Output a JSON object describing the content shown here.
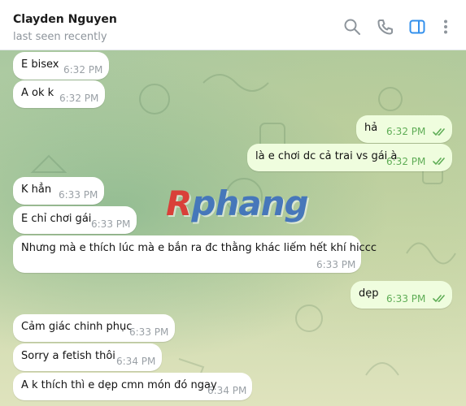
{
  "header": {
    "contact_name": "Clayden Nguyen",
    "status": "last seen recently",
    "icons": [
      "search-icon",
      "phone-icon",
      "sidebar-toggle-icon",
      "more-vertical-icon"
    ],
    "accent_color": "#3390ec"
  },
  "watermark": {
    "first": "R",
    "rest": "phang"
  },
  "messages": [
    {
      "dir": "in",
      "text": "E bisex",
      "time": "6:32 PM"
    },
    {
      "dir": "in",
      "text": "A ok k",
      "time": "6:32 PM"
    },
    {
      "dir": "out",
      "text": "hả",
      "time": "6:32 PM",
      "read": true
    },
    {
      "dir": "out",
      "text": "là e chơi dc cả trai vs gái à",
      "time": "6:32 PM",
      "read": true
    },
    {
      "dir": "in",
      "text": "K hẳn",
      "time": "6:33 PM"
    },
    {
      "dir": "in",
      "text": "E chỉ chơi gái",
      "time": "6:33 PM"
    },
    {
      "dir": "in",
      "text": "Nhưng mà e thích lúc mà e bắn ra đc thằng khác liếm hết khí hiccc",
      "time": "6:33 PM"
    },
    {
      "dir": "out",
      "text": "dẹp",
      "time": "6:33 PM",
      "read": true
    },
    {
      "dir": "in",
      "text": "Cảm giác chinh phục",
      "time": "6:33 PM"
    },
    {
      "dir": "in",
      "text": "Sorry a fetish thôi",
      "time": "6:34 PM"
    },
    {
      "dir": "in",
      "text": "A k thích thì e dẹp cmn món đó ngay",
      "time": "6:34 PM"
    }
  ]
}
